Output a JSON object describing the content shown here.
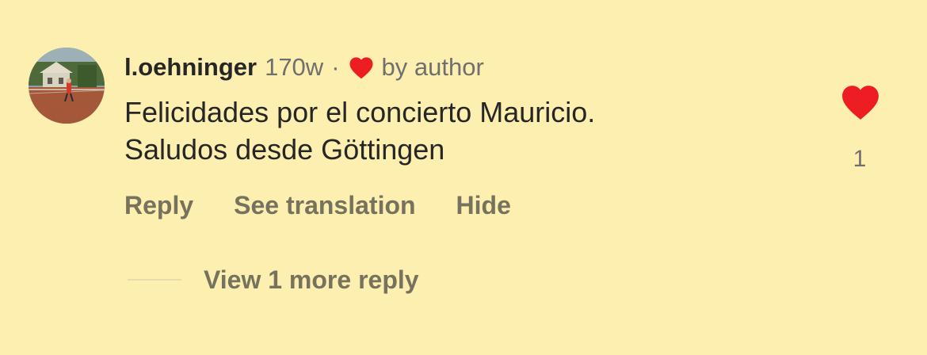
{
  "comment": {
    "username": "l.oehninger",
    "timestamp": "170w",
    "separator": "·",
    "liked_by_author_label": "by author",
    "text_line_1": "Felicidades por el concierto Mauricio.",
    "text_line_2": "Saludos desde Göttingen",
    "like_count": "1",
    "actions": {
      "reply": "Reply",
      "see_translation": "See translation",
      "hide": "Hide"
    },
    "view_replies": "View 1 more reply",
    "icons": {
      "author_heart": "heart-icon",
      "like": "heart-filled-icon"
    },
    "colors": {
      "background": "#fcefaf",
      "heart": "#ed1d24",
      "primary_text": "#262626",
      "secondary_text": "#6f6f6f",
      "action_text": "#76725d"
    }
  }
}
